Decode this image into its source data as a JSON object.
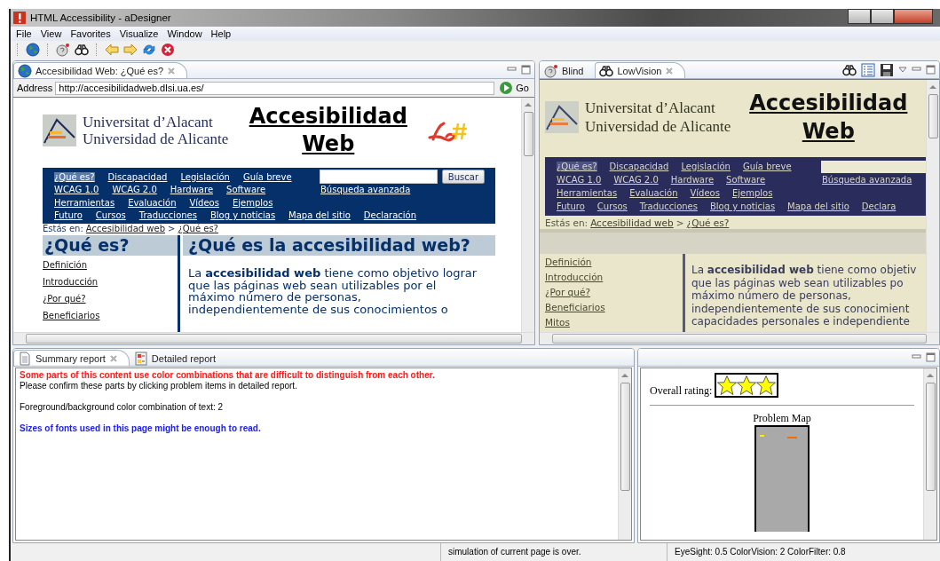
{
  "window": {
    "title": "HTML Accessibility - aDesigner"
  },
  "menu": [
    "File",
    "View",
    "Favorites",
    "Visualize",
    "Window",
    "Help"
  ],
  "browser": {
    "tab": {
      "label": "Accesibilidad Web: ¿Qué es?",
      "selected": true
    },
    "address_label": "Address",
    "address": "http://accesibilidadweb.dlsi.ua.es/",
    "go_label": "Go",
    "page": {
      "kind": "normal",
      "logo_lines": [
        "Universitat d’Alacant",
        "Universidad de Alicante"
      ],
      "title": "Accesibilidad Web",
      "nav": [
        {
          "links": [
            {
              "label": "¿Qué es?",
              "selected": true
            },
            {
              "label": "Discapacidad",
              "selected": false
            },
            {
              "label": "Legislación",
              "selected": false
            },
            {
              "label": "Guía breve",
              "selected": false
            }
          ],
          "extra": {
            "kind": "search",
            "button": "Buscar"
          }
        },
        {
          "links": [
            {
              "label": "WCAG 1.0",
              "selected": false
            },
            {
              "label": "WCAG 2.0",
              "selected": false
            },
            {
              "label": "Hardware",
              "selected": false
            },
            {
              "label": "Software",
              "selected": false
            }
          ],
          "extra": {
            "kind": "link",
            "label": "Búsqueda avanzada"
          }
        },
        {
          "links": [
            {
              "label": "Herramientas",
              "selected": false
            },
            {
              "label": "Evaluación",
              "selected": false
            },
            {
              "label": "Vídeos",
              "selected": false
            },
            {
              "label": "Ejemplos",
              "selected": false
            }
          ]
        },
        {
          "links": [
            {
              "label": "Futuro",
              "selected": false
            },
            {
              "label": "Cursos",
              "selected": false
            },
            {
              "label": "Traducciones",
              "selected": false
            },
            {
              "label": "Blog y noticias",
              "selected": false
            },
            {
              "label": "Mapa del sitio",
              "selected": false
            },
            {
              "label": "Declaración",
              "selected": false
            }
          ]
        }
      ],
      "breadcrumb": {
        "label": "Estás en:",
        "trail": [
          "Accesibilidad web",
          "¿Qué es?"
        ],
        "separator": ">"
      },
      "side_heading": "¿Qué es?",
      "side_links": [
        "Definición",
        "Introducción",
        "¿Por qué?",
        "Beneficiarios"
      ],
      "main_heading": "¿Qué es la accesibilidad web?",
      "lines": [
        "La **accesibilidad web** tiene como objetivo lograr",
        "que las páginas web sean utilizables por el",
        "máximo número de personas,",
        "independientemente de sus conocimientos o"
      ]
    }
  },
  "simulation": {
    "tabs": [
      {
        "label": "Blind",
        "selected": false
      },
      {
        "label": "LowVision",
        "selected": true
      }
    ],
    "page": {
      "kind": "low_vision",
      "logo_lines": [
        "Universitat d’Alacant",
        "Universidad de Alicante"
      ],
      "title": "Accesibilidad Web",
      "nav": [
        {
          "links": [
            {
              "label": "¿Qué es?",
              "selected": true
            },
            {
              "label": "Discapacidad",
              "selected": false
            },
            {
              "label": "Legislación",
              "selected": false
            },
            {
              "label": "Guía breve",
              "selected": false
            }
          ],
          "extra": {
            "kind": "search"
          }
        },
        {
          "links": [
            {
              "label": "WCAG 1.0",
              "selected": false
            },
            {
              "label": "WCAG 2.0",
              "selected": false
            },
            {
              "label": "Hardware",
              "selected": false
            },
            {
              "label": "Software",
              "selected": false
            }
          ],
          "extra": {
            "kind": "link",
            "label": "Búsqueda avanzada"
          }
        },
        {
          "links": [
            {
              "label": "Herramientas",
              "selected": false
            },
            {
              "label": "Evaluación",
              "selected": false
            },
            {
              "label": "Vídeos",
              "selected": false
            },
            {
              "label": "Ejemplos",
              "selected": false
            }
          ]
        },
        {
          "links": [
            {
              "label": "Futuro",
              "selected": false
            },
            {
              "label": "Cursos",
              "selected": false
            },
            {
              "label": "Traducciones",
              "selected": false
            },
            {
              "label": "Blog y noticias",
              "selected": false
            },
            {
              "label": "Mapa del sitio",
              "selected": false
            },
            {
              "label": "Declara",
              "selected": false
            }
          ]
        }
      ],
      "breadcrumb": {
        "label": "Estás en:",
        "trail": [
          "Accesibilidad web",
          "¿Qué es?"
        ],
        "separator": ">"
      },
      "side_links": [
        "Definición",
        "Introducción",
        "¿Por qué?",
        "Beneficiarios",
        "Mitos"
      ],
      "lines": [
        "La **accesibilidad web** tiene como objetiv",
        "que las páginas web sean utilizables po",
        "máximo número de personas,",
        "independientemente de sus conocimient",
        "capacidades personales e independiente"
      ]
    }
  },
  "report": {
    "tabs": [
      {
        "label": "Summary report",
        "selected": true
      },
      {
        "label": "Detailed report",
        "selected": false
      }
    ],
    "paragraphs": [
      [
        {
          "kind": "warning",
          "text": "Some parts of this content use color combinations that are difficult to distinguish from each other."
        },
        {
          "kind": "plain",
          "text": "Please confirm these parts by clicking problem items in detailed report."
        }
      ],
      [
        {
          "kind": "plain",
          "text": "Foreground/background color combination of text: 2"
        }
      ],
      [
        {
          "kind": "info",
          "text": "Sizes of fonts used in this page might be enough to read."
        }
      ]
    ]
  },
  "rating": {
    "label": "Overall rating:",
    "stars": 3,
    "map_title": "Problem Map"
  },
  "status_bar": [
    "simulation of current page is over.",
    "EyeSight: 0.5  ColorVision: 2  ColorFilter: 0.8"
  ]
}
